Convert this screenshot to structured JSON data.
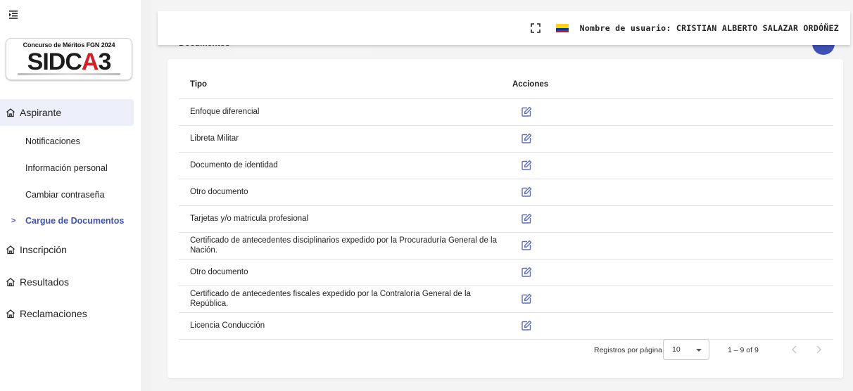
{
  "sidebar": {
    "logo": {
      "caption": "Concurso de Méritos FGN 2024",
      "brand": "SIDCA3"
    },
    "items": [
      {
        "label": "Aspirante",
        "active": true
      },
      {
        "label": "Inscripción"
      },
      {
        "label": "Resultados"
      },
      {
        "label": "Reclamaciones"
      }
    ],
    "subitems": [
      {
        "label": "Notificaciones"
      },
      {
        "label": "Información personal"
      },
      {
        "label": "Cambiar contraseña"
      },
      {
        "label": "Cargue de Documentos",
        "active": true
      }
    ],
    "chevron": ">"
  },
  "topbar": {
    "username": "Nombre de usuario: CRISTIAN ALBERTO SALAZAR ORDÓÑEZ"
  },
  "panel": {
    "title_fragment": "Documentos"
  },
  "table": {
    "headers": {
      "tipo": "Tipo",
      "acciones": "Acciones"
    },
    "rows": [
      "Enfoque diferencial",
      "Libreta Militar",
      "Documento de identidad",
      "Otro documento",
      "Tarjetas y/o matricula profesional",
      "Certificado de antecedentes disciplinarios expedido por la Procuraduría General de la Nación.",
      "Otro documento",
      "Certificado de antecedentes fiscales expedido por la Contraloría General de la República.",
      "Licencia Conducción"
    ]
  },
  "paginator": {
    "label": "Registros por página",
    "page_size": "10",
    "range": "1 – 9 of 9"
  },
  "colors": {
    "accent": "#3f51b5",
    "icon": "#5c6bc0",
    "flag_yellow": "#fcd116",
    "flag_blue": "#003893",
    "flag_red": "#ce1126"
  }
}
